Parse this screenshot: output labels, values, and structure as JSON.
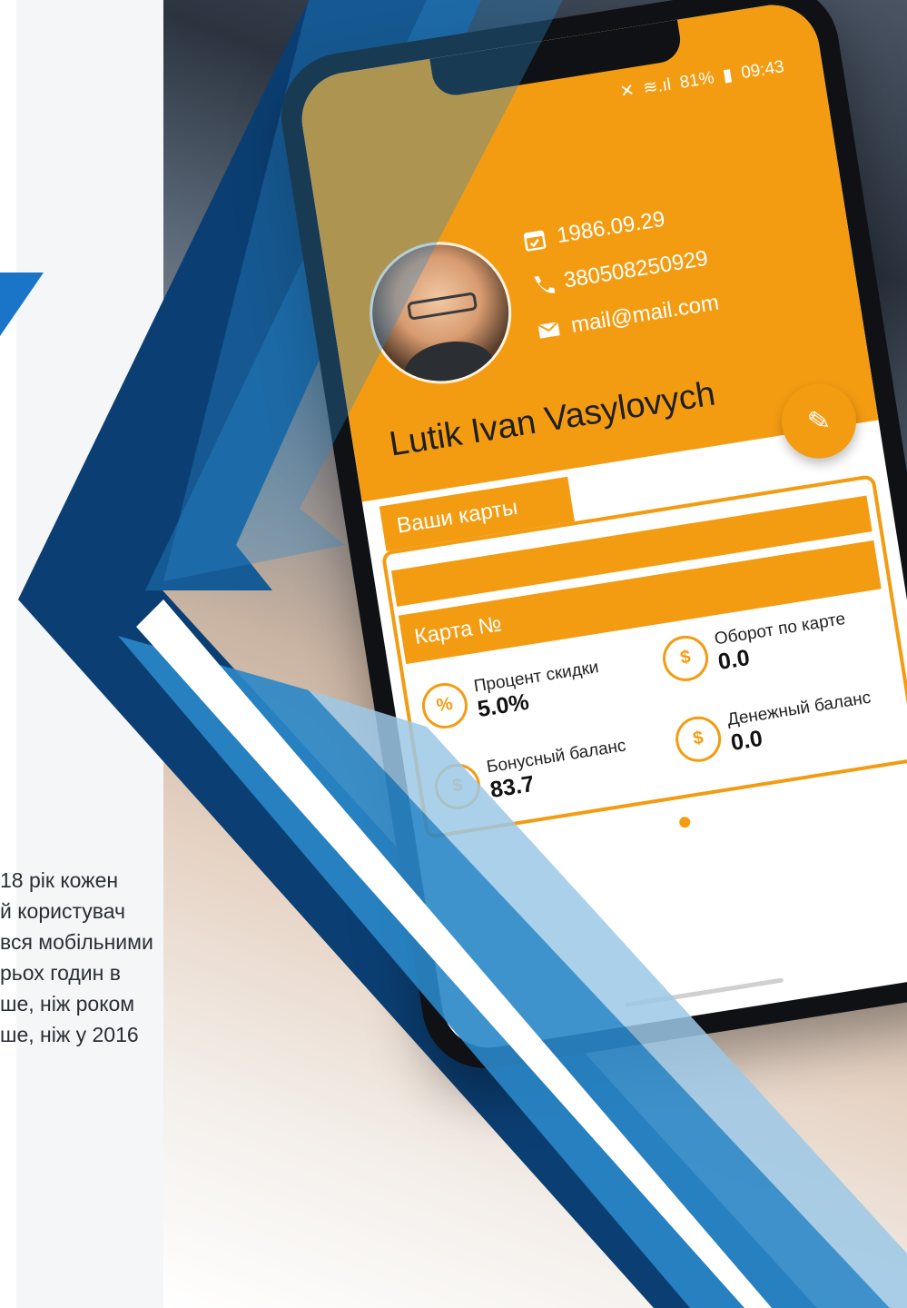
{
  "status_bar": {
    "signal": "≋.ıl",
    "battery": "81%",
    "time": "09:43"
  },
  "profile": {
    "birth_date": "1986.09.29",
    "phone": "380508250929",
    "email": "mail@mail.com",
    "name": "Lutik Ivan Vasylovych"
  },
  "cards": {
    "section_tab": "Ваши карты",
    "card_title": "Карта №",
    "discount": {
      "label": "Процент скидки",
      "value": "5.0%"
    },
    "turnover": {
      "label": "Оборот по карте",
      "value": "0.0"
    },
    "bonus_balance": {
      "label": "Бонусный баланс",
      "value": "83.7"
    },
    "money_balance": {
      "label": "Денежный баланс",
      "value": "0.0"
    }
  },
  "side_text": "18 рік кожен\nй користувач\nвся мобільними\nрьох годин в\nше, ніж роком\nше, ніж у 2016",
  "colors": {
    "accent": "#f39c12",
    "brand_blue_dark": "#0b3f73",
    "brand_blue": "#2a87c8",
    "brand_blue_light": "#9cc8e6"
  },
  "icons": [
    "calendar-icon",
    "phone-icon",
    "mail-icon",
    "edit-icon",
    "percent-icon",
    "exchange-icon",
    "hand-coin-icon",
    "dollar-icon"
  ]
}
